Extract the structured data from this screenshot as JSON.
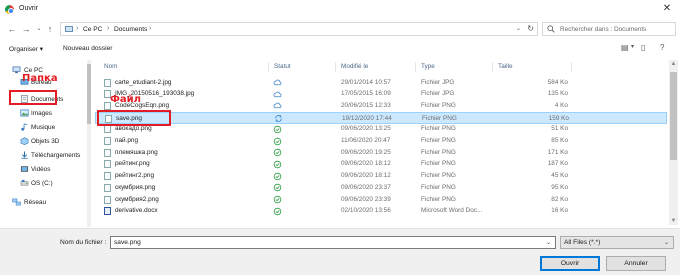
{
  "window": {
    "title": "Ouvrir"
  },
  "address": {
    "crumbs": [
      "Ce PC",
      "Documents"
    ]
  },
  "search": {
    "placeholder": "Rechercher dans : Documents"
  },
  "toolbar": {
    "organize_label": "Organiser ▾",
    "new_folder_label": "Nouveau dossier"
  },
  "nav": {
    "items": [
      {
        "label": "Ce PC",
        "icon": "computer-icon"
      },
      {
        "label": "Bureau",
        "icon": "desktop-icon"
      },
      {
        "label": "Documents",
        "icon": "documents-icon"
      },
      {
        "label": "Images",
        "icon": "images-icon"
      },
      {
        "label": "Musique",
        "icon": "music-icon"
      },
      {
        "label": "Objets 3D",
        "icon": "objects-3d-icon"
      },
      {
        "label": "Téléchargements",
        "icon": "downloads-icon"
      },
      {
        "label": "Vidéos",
        "icon": "videos-icon"
      },
      {
        "label": "OS (C:)",
        "icon": "drive-icon"
      },
      {
        "label": "Réseau",
        "icon": "network-icon"
      }
    ]
  },
  "columns": {
    "name": "Nom",
    "status": "Statut",
    "modified": "Modifié le",
    "type": "Type",
    "size": "Taille"
  },
  "files": [
    {
      "name": "carte_etudiant-2.jpg",
      "status": "cloud",
      "modified": "29/01/2014 10:57",
      "type": "Fichier JPG",
      "size": "584 Ko"
    },
    {
      "name": "IMG_20150516_193038.jpg",
      "status": "cloud",
      "modified": "17/05/2015 16:09",
      "type": "Fichier JPG",
      "size": "135 Ko"
    },
    {
      "name": "CodeCogsEqn.png",
      "status": "cloud",
      "modified": "20/06/2015 12:33",
      "type": "Fichier PNG",
      "size": "4 Ko"
    },
    {
      "name": "save.png",
      "status": "sync",
      "modified": "19/12/2020 17:44",
      "type": "Fichier PNG",
      "size": "159 Ko",
      "selected": true
    },
    {
      "name": "авокадо.png",
      "status": "ok",
      "modified": "09/06/2020 13:25",
      "type": "Fichier PNG",
      "size": "51 Ko"
    },
    {
      "name": "пай.png",
      "status": "ok",
      "modified": "11/06/2020 20:47",
      "type": "Fichier PNG",
      "size": "85 Ko"
    },
    {
      "name": "племяшка.png",
      "status": "ok",
      "modified": "09/06/2020 19:25",
      "type": "Fichier PNG",
      "size": "171 Ko"
    },
    {
      "name": "рейтинг.png",
      "status": "ok",
      "modified": "09/06/2020 18:12",
      "type": "Fichier PNG",
      "size": "187 Ko"
    },
    {
      "name": "рейтинг2.png",
      "status": "ok",
      "modified": "09/06/2020 18:12",
      "type": "Fichier PNG",
      "size": "45 Ko"
    },
    {
      "name": "скумбрия.png",
      "status": "ok",
      "modified": "09/06/2020 23:37",
      "type": "Fichier PNG",
      "size": "95 Ko"
    },
    {
      "name": "скумбрия2.png",
      "status": "ok",
      "modified": "09/06/2020 23:39",
      "type": "Fichier PNG",
      "size": "82 Ko"
    },
    {
      "name": "derivative.docx",
      "status": "ok",
      "modified": "02/10/2020 13:56",
      "type": "Microsoft Word Doc...",
      "size": "16 Ko",
      "doc": true
    }
  ],
  "footer": {
    "filename_label": "Nom du fichier :",
    "filename_value": "save.png",
    "filetype_value": "All Files (*.*)",
    "open_label": "Ouvrir",
    "cancel_label": "Annuler"
  },
  "annotations": {
    "folder": "Папка",
    "file": "Файл"
  },
  "colors": {
    "accent": "#0078d7",
    "selection": "#cce8ff",
    "annotation": "#e31b23",
    "ok": "#2e9e44",
    "cloud": "#3a86c8"
  }
}
